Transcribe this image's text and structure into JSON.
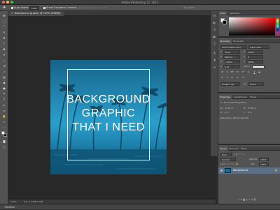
{
  "app": {
    "title": "Adobe Photoshop CC 2017"
  },
  "options_bar": {
    "tool_icon": "move-tool-icon",
    "auto_select_label": "Auto-Select:",
    "auto_select_value": "Layer",
    "transform_label": "Show Transform Controls"
  },
  "document": {
    "tab_label": "Background graphic @ 100% (RGB/8)"
  },
  "artwork": {
    "line1": "BACKGROUND",
    "line2": "GRAPHIC",
    "line3": "THAT I NEED",
    "colors": {
      "sky_top": "#1b6f93",
      "sky_mid": "#2497c4",
      "water": "#0f5575",
      "text": "#ffffff"
    }
  },
  "status": {
    "zoom": "100%",
    "doc_size": "Doc: 1.43M/1.43M"
  },
  "timeline": {
    "label": "Timeline"
  },
  "toolbar": {
    "tools": [
      "move-tool",
      "marquee-tool",
      "lasso-tool",
      "quick-select-tool",
      "crop-tool",
      "eyedropper-tool",
      "healing-brush-tool",
      "brush-tool",
      "clone-stamp-tool",
      "history-brush-tool",
      "eraser-tool",
      "gradient-tool",
      "blur-tool",
      "dodge-tool",
      "pen-tool",
      "type-tool",
      "path-select-tool",
      "rectangle-tool",
      "hand-tool",
      "zoom-tool"
    ],
    "foreground_color": "#ffffff",
    "background_color": "#000000"
  },
  "color_panel": {
    "tabs": [
      "Color",
      "Swatches"
    ]
  },
  "character_panel": {
    "tabs": [
      "Character",
      "Paragraph"
    ],
    "font_family": "Avenir Next LT Pro",
    "font_style": "Ultra Light",
    "font_size": "36 pt",
    "leading": "(Auto)",
    "kerning": "Metrics",
    "tracking": "0",
    "vscale": "100%",
    "hscale": "100%",
    "baseline": "0 pt",
    "color_label": "Color:",
    "language": "English: UK",
    "antialias": "Sharp"
  },
  "properties_panel": {
    "tabs": [
      "Properties",
      "Adjustments",
      "Styles"
    ],
    "section_label": "Document Properties",
    "w_label": "W:",
    "w_value": "27.87 in",
    "h_label": "H:",
    "h_value": "27.87 in",
    "x_label": "X:",
    "x_value": "0 in",
    "y_label": "Y:",
    "y_value": "0 in",
    "resolution": "Resolution: 100 pixels/inch"
  },
  "layers_panel": {
    "tabs": [
      "Layers",
      "Channels",
      "Paths"
    ],
    "kind_label": "Kind",
    "blend_mode": "Normal",
    "opacity_label": "Opacity:",
    "opacity_value": "100%",
    "lock_label": "Lock:",
    "fill_label": "Fill:",
    "fill_value": "100%",
    "layers": [
      {
        "name": "Background"
      }
    ]
  }
}
